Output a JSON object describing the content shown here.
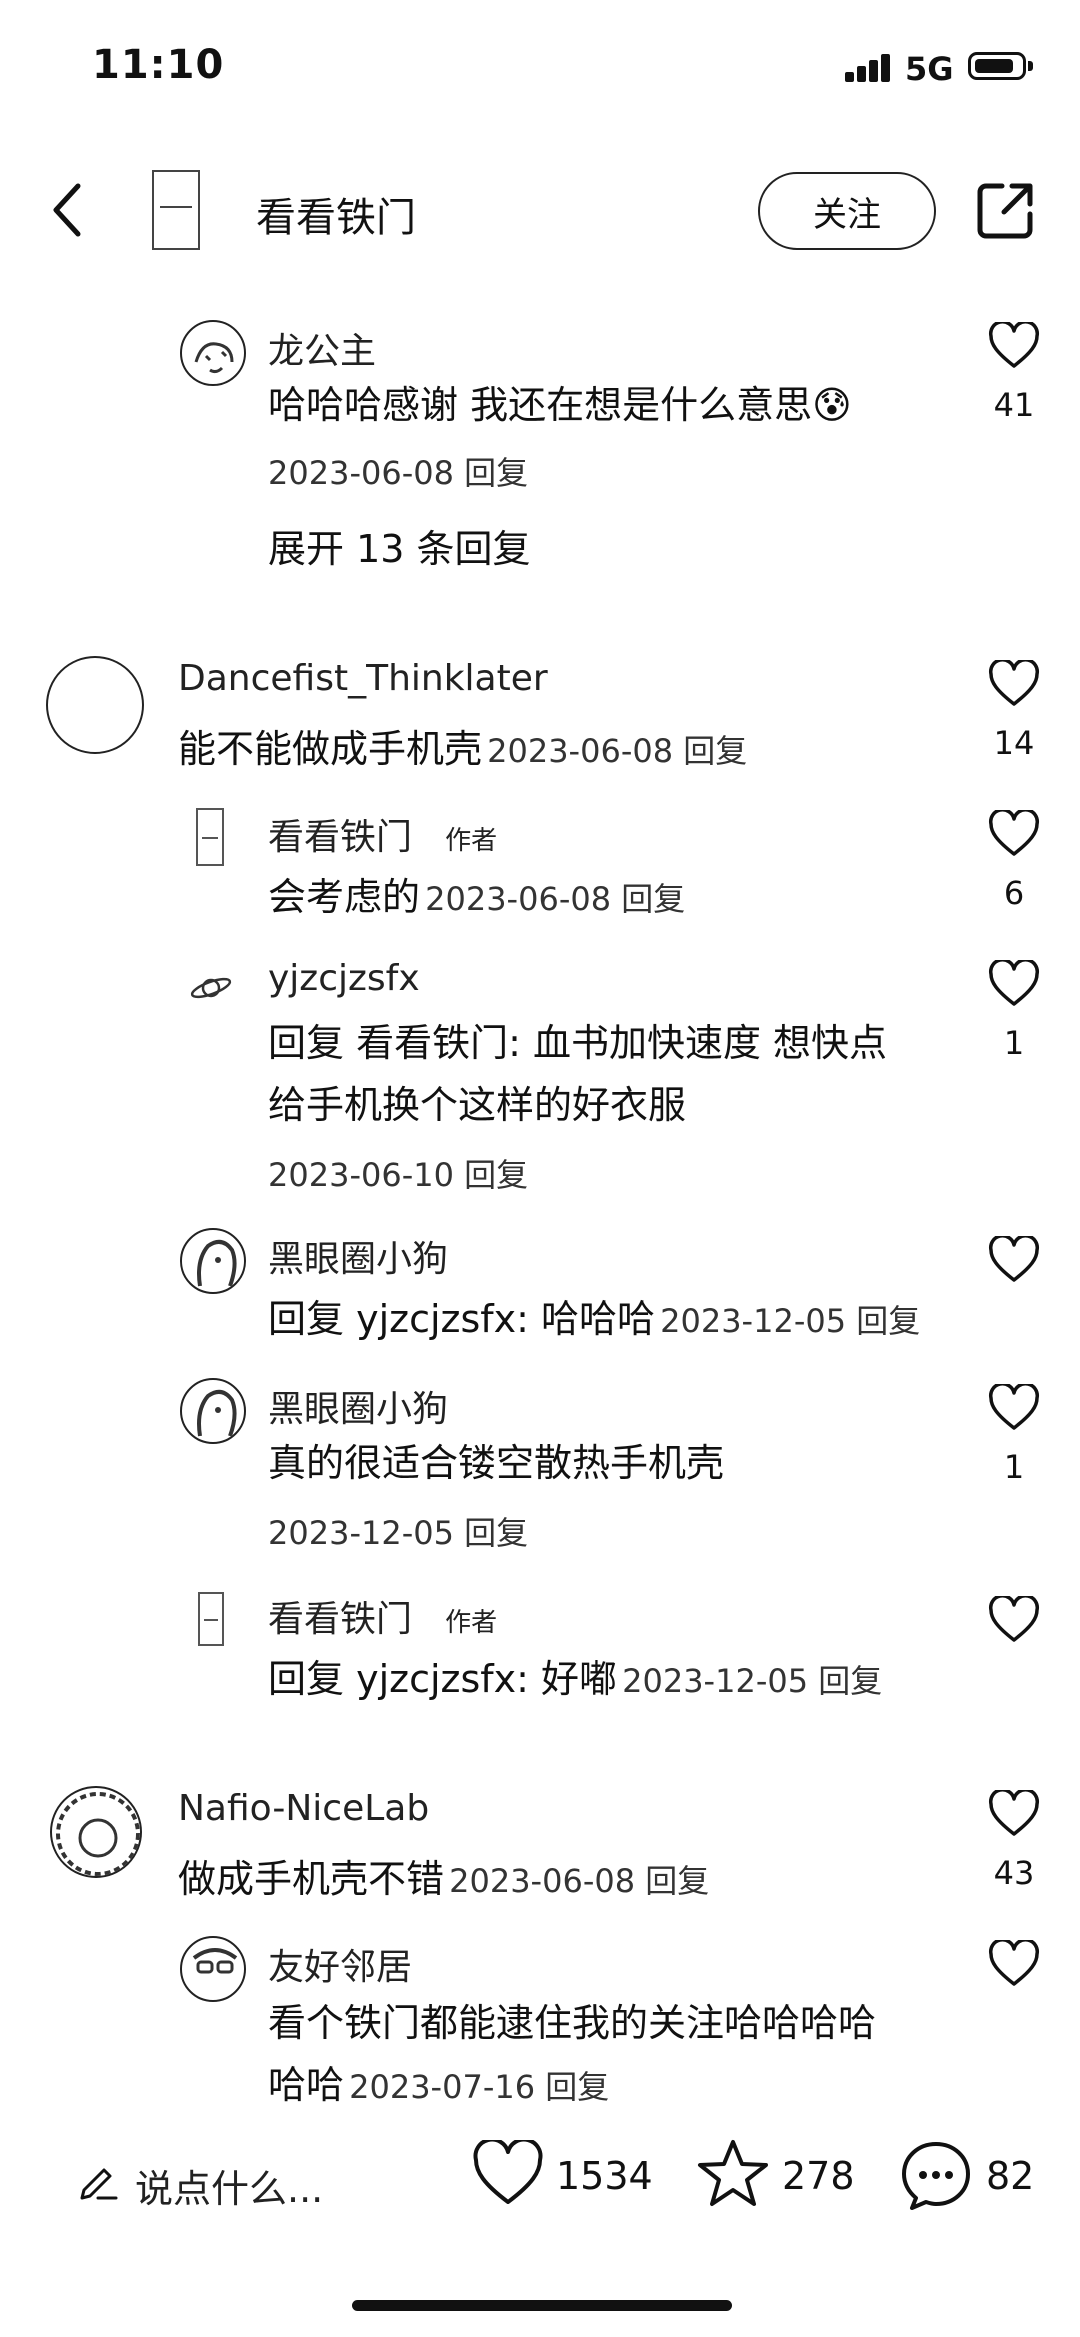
{
  "status": {
    "time": "11:10",
    "network": "5G"
  },
  "header": {
    "title": "看看铁门",
    "follow_label": "关注"
  },
  "comments": [
    {
      "name": "龙公主",
      "text": "哈哈哈感谢 我还在想是什么意思😰",
      "meta": "2023-06-08 回复",
      "likes": "41",
      "expand": "展开 13 条回复"
    },
    {
      "name": "Dancefist_Thinklater",
      "text": "能不能做成手机壳",
      "date": "2023-06-08 回复",
      "likes": "14"
    },
    {
      "name": "看看铁门",
      "tag": "作者",
      "text": "会考虑的",
      "date": "2023-06-08 回复",
      "likes": "6"
    },
    {
      "name": "yjzcjzsfx",
      "text1": "回复 看看铁门: 血书加快速度 想快点",
      "text2": "给手机换个这样的好衣服",
      "meta": "2023-06-10 回复",
      "likes": "1"
    },
    {
      "name": "黑眼圈小狗",
      "text": "回复 yjzcjzsfx: 哈哈哈",
      "date": "2023-12-05 回复",
      "likes": ""
    },
    {
      "name": "黑眼圈小狗",
      "text": "真的很适合镂空散热手机壳",
      "meta": "2023-12-05 回复",
      "likes": "1"
    },
    {
      "name": "看看铁门",
      "tag": "作者",
      "text": "回复 yjzcjzsfx: 好嘟",
      "date": "2023-12-05 回复",
      "likes": ""
    },
    {
      "name": "Nafio-NiceLab",
      "text": "做成手机壳不错",
      "date": "2023-06-08 回复",
      "likes": "43"
    },
    {
      "name": "友好邻居",
      "text1": "看个铁门都能逮住我的关注哈哈哈哈",
      "text2": "哈哈",
      "date": "2023-07-16 回复",
      "likes": ""
    }
  ],
  "bottom": {
    "placeholder": "说点什么...",
    "likes": "1534",
    "stars": "278",
    "comments": "82"
  }
}
